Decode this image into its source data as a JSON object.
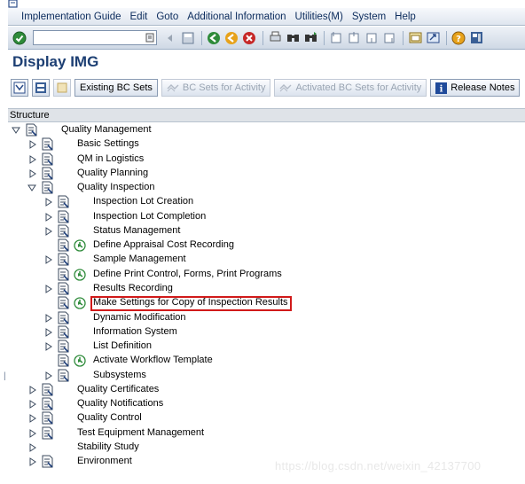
{
  "menubar": {
    "items": [
      "Implementation Guide",
      "Edit",
      "Goto",
      "Additional Information",
      "Utilities(M)",
      "System",
      "Help"
    ]
  },
  "toolbar": {
    "command_value": "",
    "icons": [
      "enter-icon",
      "dropdown-icon",
      "back-icon",
      "save-icon",
      "back-green-icon",
      "exit-icon",
      "cancel-icon",
      "print-icon",
      "find-icon",
      "find-next-icon",
      "first-page-icon",
      "prev-page-icon",
      "next-page-icon",
      "last-page-icon",
      "create-session-icon",
      "shortcut-icon",
      "help-icon",
      "layout-icon"
    ]
  },
  "page": {
    "title": "Display IMG"
  },
  "app_toolbar": {
    "existing_bc_sets": "Existing BC Sets",
    "bc_sets_for_activity": "BC Sets for Activity",
    "activated_bc_sets": "Activated BC Sets for Activity",
    "release_notes": "Release Notes"
  },
  "tree": {
    "header": "Structure",
    "nodes": [
      {
        "label": "Quality Management",
        "expanded": true
      },
      {
        "label": "Basic Settings"
      },
      {
        "label": "QM in Logistics"
      },
      {
        "label": "Quality Planning"
      },
      {
        "label": "Quality Inspection",
        "expanded": true
      },
      {
        "label": "Inspection Lot Creation"
      },
      {
        "label": "Inspection Lot Completion"
      },
      {
        "label": "Status Management"
      },
      {
        "label": "Define Appraisal Cost Recording"
      },
      {
        "label": "Sample Management"
      },
      {
        "label": "Define Print Control, Forms, Print Programs"
      },
      {
        "label": "Results Recording"
      },
      {
        "label": "Make Settings for Copy of Inspection Results",
        "highlighted": true
      },
      {
        "label": "Dynamic Modification"
      },
      {
        "label": "Information System"
      },
      {
        "label": "List Definition"
      },
      {
        "label": "Activate Workflow Template"
      },
      {
        "label": "Subsystems"
      },
      {
        "label": "Quality Certificates"
      },
      {
        "label": "Quality Notifications"
      },
      {
        "label": "Quality Control"
      },
      {
        "label": "Test Equipment Management"
      },
      {
        "label": "Stability Study"
      },
      {
        "label": "Environment"
      }
    ]
  },
  "watermark": "https://blog.csdn.net/weixin_42137700",
  "colors": {
    "highlight": "#d11a1a",
    "title": "#1d3f73",
    "execute": "#2e8b3a"
  }
}
